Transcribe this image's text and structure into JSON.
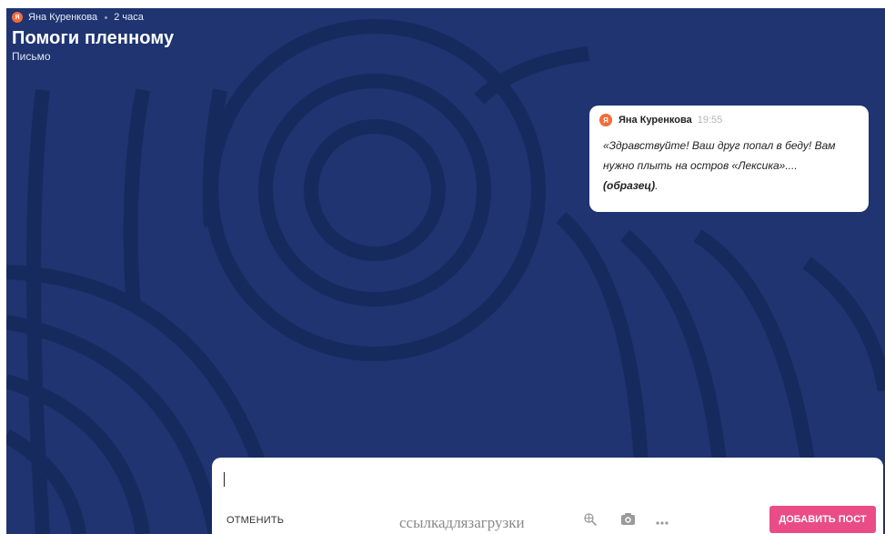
{
  "header": {
    "author": "Яна Куренкова",
    "avatar_letter": "Я",
    "time_ago": "2 часа",
    "title": "Помоги пленному",
    "subtitle": "Письмо"
  },
  "post": {
    "author": "Яна Куренкова",
    "avatar_letter": "Я",
    "time": "19:55",
    "text": "«Здравствуйте! Ваш друг попал в беду! Вам нужно плыть на остров «Лексика»....",
    "bold_text": "(образец)",
    "trailing": "."
  },
  "composer": {
    "cancel_label": "ОТМЕНИТЬ",
    "link_text": "ссылкадлязагрузки",
    "add_label": "ДОБАВИТЬ ПОСТ",
    "icons": [
      "link-search-icon",
      "camera-icon",
      "more-icon"
    ]
  },
  "colors": {
    "background": "#1f3470",
    "pattern": "#172a5e",
    "accent": "#e94c86",
    "avatar": "#f26b3a"
  }
}
